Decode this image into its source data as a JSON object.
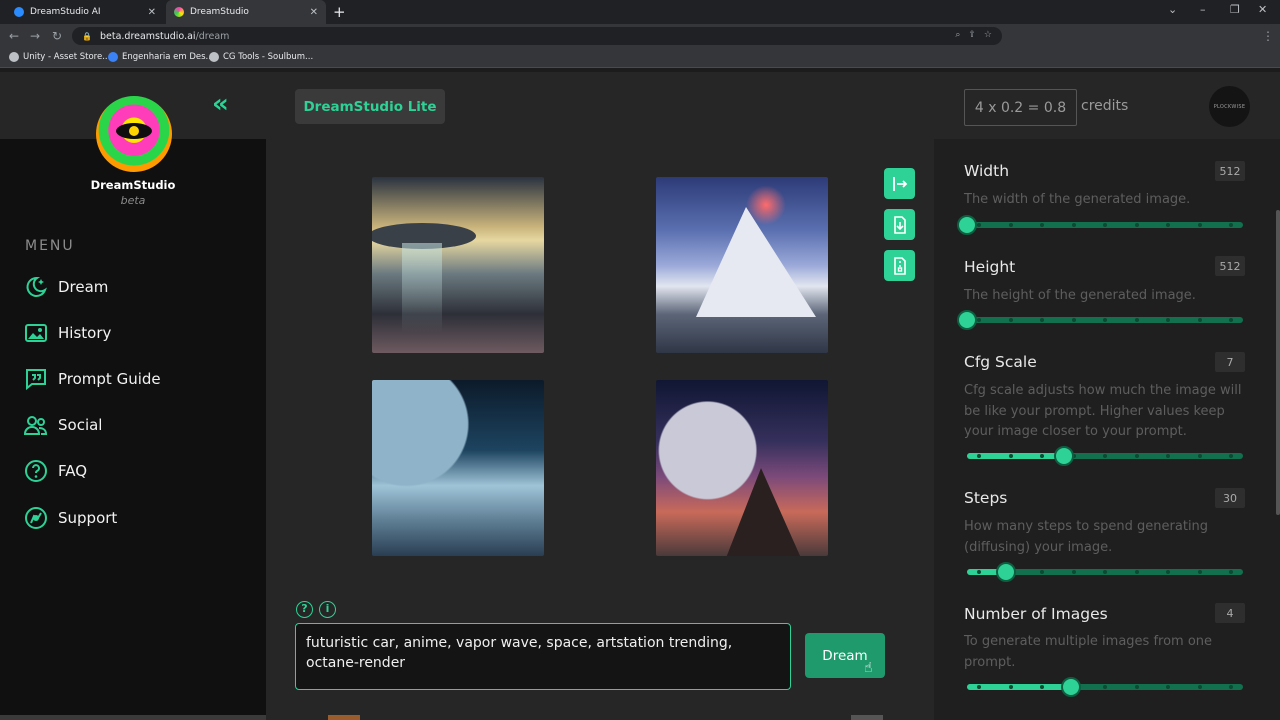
{
  "browser": {
    "tabs": [
      {
        "title": "DreamStudio AI",
        "active": false
      },
      {
        "title": "DreamStudio",
        "active": true
      }
    ],
    "url_host": "beta.dreamstudio.ai",
    "url_path": "/dream",
    "bookmarks": [
      "Unity - Asset Store...",
      "Engenharia em Des...",
      "CG Tools - Soulbum..."
    ]
  },
  "sidebar": {
    "brand": "DreamStudio",
    "brand_sub": "beta",
    "menu_heading": "MENU",
    "items": [
      {
        "label": "Dream",
        "icon": "moon-sparkle-icon"
      },
      {
        "label": "History",
        "icon": "image-gallery-icon"
      },
      {
        "label": "Prompt Guide",
        "icon": "quote-bubble-icon"
      },
      {
        "label": "Social",
        "icon": "users-icon"
      },
      {
        "label": "FAQ",
        "icon": "question-icon"
      },
      {
        "label": "Support",
        "icon": "support-icon"
      }
    ]
  },
  "header": {
    "badge": "DreamStudio Lite",
    "credits_formula": "4 x 0.2 = 0.8",
    "credits_label": "credits",
    "avatar_text": "PLOCKWISE"
  },
  "prompt": {
    "value": "futuristic car, anime, vapor wave, space, artstation trending, octane-render",
    "dream_button": "Dream"
  },
  "settings": [
    {
      "title": "Width",
      "value": "512",
      "description": "The width of the generated image.",
      "level": 0.0
    },
    {
      "title": "Height",
      "value": "512",
      "description": "The height of the generated image.",
      "level": 0.0
    },
    {
      "title": "Cfg Scale",
      "value": "7",
      "description": "Cfg scale adjusts how much the image will be like your prompt. Higher values keep your image closer to your prompt.",
      "level": 0.35
    },
    {
      "title": "Steps",
      "value": "30",
      "description": "How many steps to spend generating (diffusing) your image.",
      "level": 0.14
    },
    {
      "title": "Number of Images",
      "value": "4",
      "description": "To generate multiple images from one prompt.",
      "level": 0.375
    }
  ],
  "colors": {
    "accent": "#2ed196",
    "accent_dark": "#12704f"
  }
}
